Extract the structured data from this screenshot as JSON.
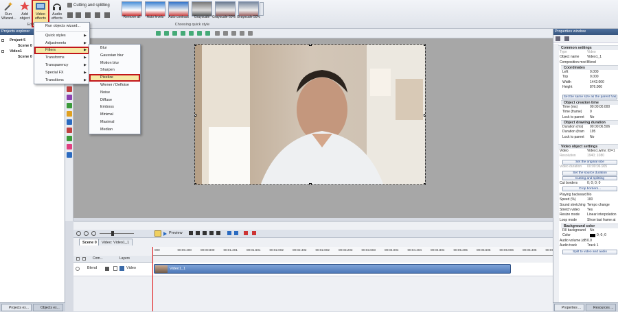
{
  "ribbon": {
    "run_wizard": "Run Wizard...",
    "add_object": "Add object",
    "video_effects": "Video effects",
    "audio_effects": "Audio effects",
    "group_edit": "Editi",
    "cutting": "Cutting and splitting",
    "quick_style_label": "Choosing quick style",
    "styles": [
      "Remove all",
      "Auto levels",
      "Auto contrast",
      "Grayscale",
      "Grayscale 60%",
      "Grayscale 50%"
    ]
  },
  "projects": {
    "title": "Projects explorer",
    "items": [
      "Project 5",
      "Scene 0",
      "Video1",
      "Scene 0"
    ],
    "tabs": [
      "Projects ex...",
      "Objects ex..."
    ]
  },
  "menu_main": {
    "items": [
      "Run objects wizard...",
      "Quick styles",
      "Adjustments",
      "Filters",
      "Transforms",
      "Transparency",
      "Special FX",
      "Transitions"
    ]
  },
  "menu_filters": {
    "items": [
      "Blur",
      "Gaussian blur",
      "Motion blur",
      "Sharpen",
      "Pixelize",
      "Wiener / Defloise",
      "Noise",
      "Diffuse",
      "Emboss",
      "Minimal",
      "Maximal",
      "Median"
    ]
  },
  "timeline": {
    "preview": "Preview",
    "tabs": [
      "Scene 0",
      "Video: Video1_1"
    ],
    "ticks": [
      "000",
      "00:00.400",
      "00:00.800",
      "00:01.201",
      "00:01.601",
      "00:02.002",
      "00:02.402",
      "00:02.802",
      "00:03.203",
      "00:03.603",
      "00:04.004",
      "00:04.404",
      "00:04.804",
      "00:05.205",
      "00:05.605",
      "00:06.006",
      "00:06.406",
      "00:06.806"
    ],
    "col_com": "Com...",
    "col_layers": "Layers",
    "track_blend": "Blend",
    "track_name": "Video",
    "clip_label": "Video1_1"
  },
  "properties": {
    "title": "Properties window",
    "sections": {
      "common": "Common settings",
      "coords": "Coordinates",
      "creation": "Object creation time",
      "duration": "Object drawing duration",
      "video": "Video object settings",
      "bg": "Background color"
    },
    "rows": {
      "type_k": "Type",
      "type_v": "Video",
      "name_k": "Object name",
      "name_v": "Video1_1",
      "comp_k": "Composition mod",
      "comp_v": "Blend",
      "left_k": "Left",
      "left_v": "0.000",
      "top_k": "Top",
      "top_v": "0.000",
      "width_k": "Width",
      "width_v": "1442.000",
      "height_k": "Height",
      "height_v": "876.000",
      "tms_k": "Time (ms)",
      "tms_v": "00:00:00.000",
      "tfr_k": "Time (frame)",
      "tfr_v": "0",
      "lock1_k": "Lock to parent",
      "lock1_v": "No",
      "dms_k": "Duration (ms)",
      "dms_v": "00:00:06.506",
      "dfr_k": "Duration (fram",
      "dfr_v": "195",
      "lock2_k": "Lock to parent",
      "lock2_v": "No",
      "video_k": "Video",
      "video_v": "Video1.wmv; ID=1",
      "res_k": "Resolution",
      "res_v": "1940; 1080",
      "vdur_k": "Video duration",
      "vdur_v": "00:00:06.905",
      "cut_k": "Cut borders",
      "cut_v": "0; 0; 0; 0",
      "pb_k": "Playing backward",
      "pb_v": "No",
      "speed_k": "Speed (%)",
      "speed_v": "100",
      "stretch_k": "Sound stretching",
      "stretch_v": "Tempo change",
      "sv_k": "Stretch video",
      "sv_v": "Yes",
      "resize_k": "Resize mode",
      "resize_v": "Linear interpolation",
      "loop_k": "Loop mode",
      "loop_v": "Show last frame at",
      "fill_k": "Fill background",
      "fill_v": "No",
      "color_k": "Color",
      "color_v": "0; 0; 0",
      "vol_k": "Audio volume (dB",
      "vol_v": "0.0",
      "track_k": "Audio track",
      "track_v": "Track 1"
    },
    "buttons": {
      "same_size": "Set the same size as the parent has",
      "orig_size": "Set the original size",
      "src_dur": "Set the source duration",
      "cutting": "Cutting and splitting",
      "crop": "Crop borders...",
      "split": "Split to video and audio"
    },
    "tabs": [
      "Properties ...",
      "Resources ..."
    ]
  }
}
